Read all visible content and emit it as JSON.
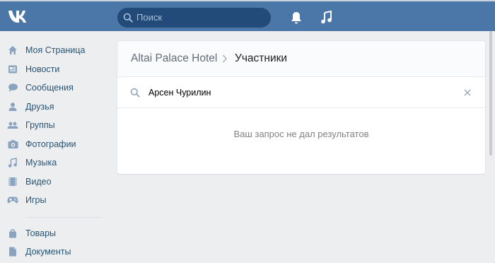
{
  "header": {
    "search_placeholder": "Поиск",
    "icons": [
      "vk-logo-icon",
      "search-icon",
      "bell-icon",
      "music-note-icon"
    ],
    "colors": {
      "bar": "#4a76a8",
      "search_bg": "#224b7a"
    }
  },
  "sidebar": {
    "items": [
      {
        "label": "Моя Страница",
        "icon": "home-icon"
      },
      {
        "label": "Новости",
        "icon": "news-icon"
      },
      {
        "label": "Сообщения",
        "icon": "messages-icon"
      },
      {
        "label": "Друзья",
        "icon": "friend-icon"
      },
      {
        "label": "Группы",
        "icon": "groups-icon"
      },
      {
        "label": "Фотографии",
        "icon": "camera-icon"
      },
      {
        "label": "Музыка",
        "icon": "music-icon"
      },
      {
        "label": "Видео",
        "icon": "film-icon"
      },
      {
        "label": "Игры",
        "icon": "gamepad-icon"
      }
    ],
    "extra_items": [
      {
        "label": "Товары",
        "icon": "bag-icon"
      },
      {
        "label": "Документы",
        "icon": "document-icon"
      }
    ]
  },
  "main": {
    "breadcrumb": {
      "parent": "Altai Palace Hotel",
      "current": "Участники"
    },
    "search": {
      "value": "Арсен Чурилин"
    },
    "empty_message": "Ваш запрос не дал результатов"
  }
}
